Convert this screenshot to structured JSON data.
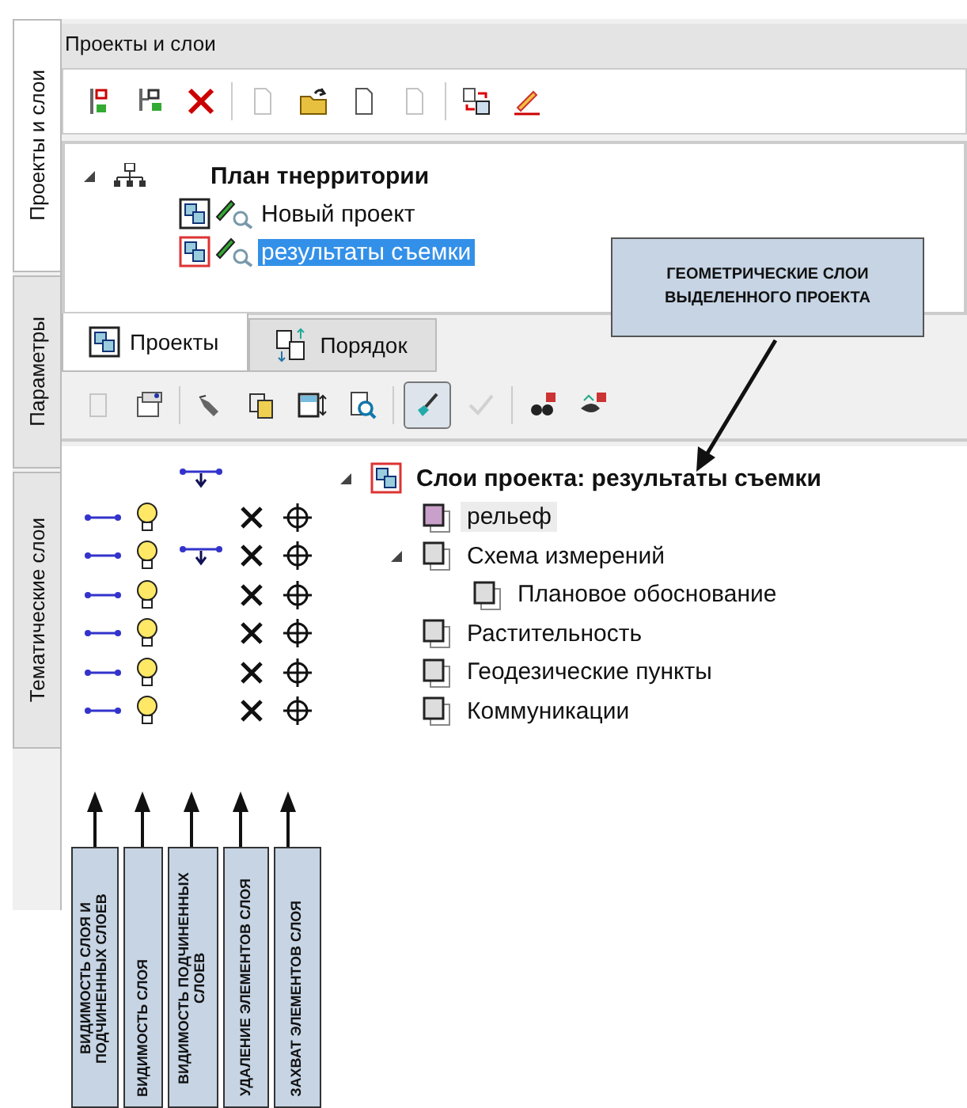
{
  "panel_title": "Проекты и слои",
  "side_tabs": [
    {
      "label": "Проекты и слои",
      "selected": true
    },
    {
      "label": "Параметры",
      "selected": false
    },
    {
      "label": "Тематические слои",
      "selected": false
    }
  ],
  "toolbar": [
    {
      "disabled": false
    },
    {
      "disabled": false
    },
    {
      "disabled": false
    },
    {
      "disabled": true
    },
    {
      "disabled": false
    },
    {
      "disabled": false
    },
    {
      "disabled": true
    },
    {
      "disabled": false
    },
    {
      "disabled": false
    }
  ],
  "project_tree": {
    "label": "План тнерритории",
    "expanded": true,
    "children": [
      {
        "label": "Новый проект",
        "selected": false
      },
      {
        "label": "результаты съемки",
        "selected": true
      }
    ]
  },
  "bottom_tabs": [
    {
      "label": "Проекты",
      "selected": true
    },
    {
      "label": "Порядок",
      "selected": false
    }
  ],
  "layer_toolbar": [
    {
      "disabled": true,
      "pressed": false
    },
    {
      "disabled": false,
      "pressed": false
    },
    {
      "disabled": false,
      "pressed": false
    },
    {
      "disabled": false,
      "pressed": false
    },
    {
      "disabled": false,
      "pressed": false
    },
    {
      "disabled": false,
      "pressed": false
    },
    {
      "disabled": false,
      "pressed": true
    },
    {
      "disabled": true,
      "pressed": false
    },
    {
      "disabled": false,
      "pressed": false
    },
    {
      "disabled": false,
      "pressed": false
    }
  ],
  "layers": {
    "label": "Слои проекта: результаты съемки",
    "expanded": true,
    "children": [
      {
        "label": "рельеф",
        "selected": true
      },
      {
        "label": "Схема измерений",
        "selected": false,
        "expanded": true,
        "children": [
          {
            "label": "Плановое обоснование",
            "selected": false
          }
        ]
      },
      {
        "label": "Растительность",
        "selected": false
      },
      {
        "label": "Геодезические пункты",
        "selected": false
      },
      {
        "label": "Коммуникации",
        "selected": false
      }
    ]
  },
  "callout": "ГЕОМЕТРИЧЕСКИЕ СЛОИ ВЫДЕЛЕННОГО ПРОЕКТА",
  "column_notes": [
    "ВИДИМОСТЬ СЛОЯ И ПОДЧИНЕННЫХ СЛОЕВ",
    "ВИДИМОСТЬ СЛОЯ",
    "ВИДИМОСТЬ ПОДЧИНЕННЫХ СЛОЕВ",
    "УДАЛЕНИЕ ЭЛЕМЕНТОВ СЛОЯ",
    "ЗАХВАТ ЭЛЕМЕНТОВ СЛОЯ"
  ]
}
